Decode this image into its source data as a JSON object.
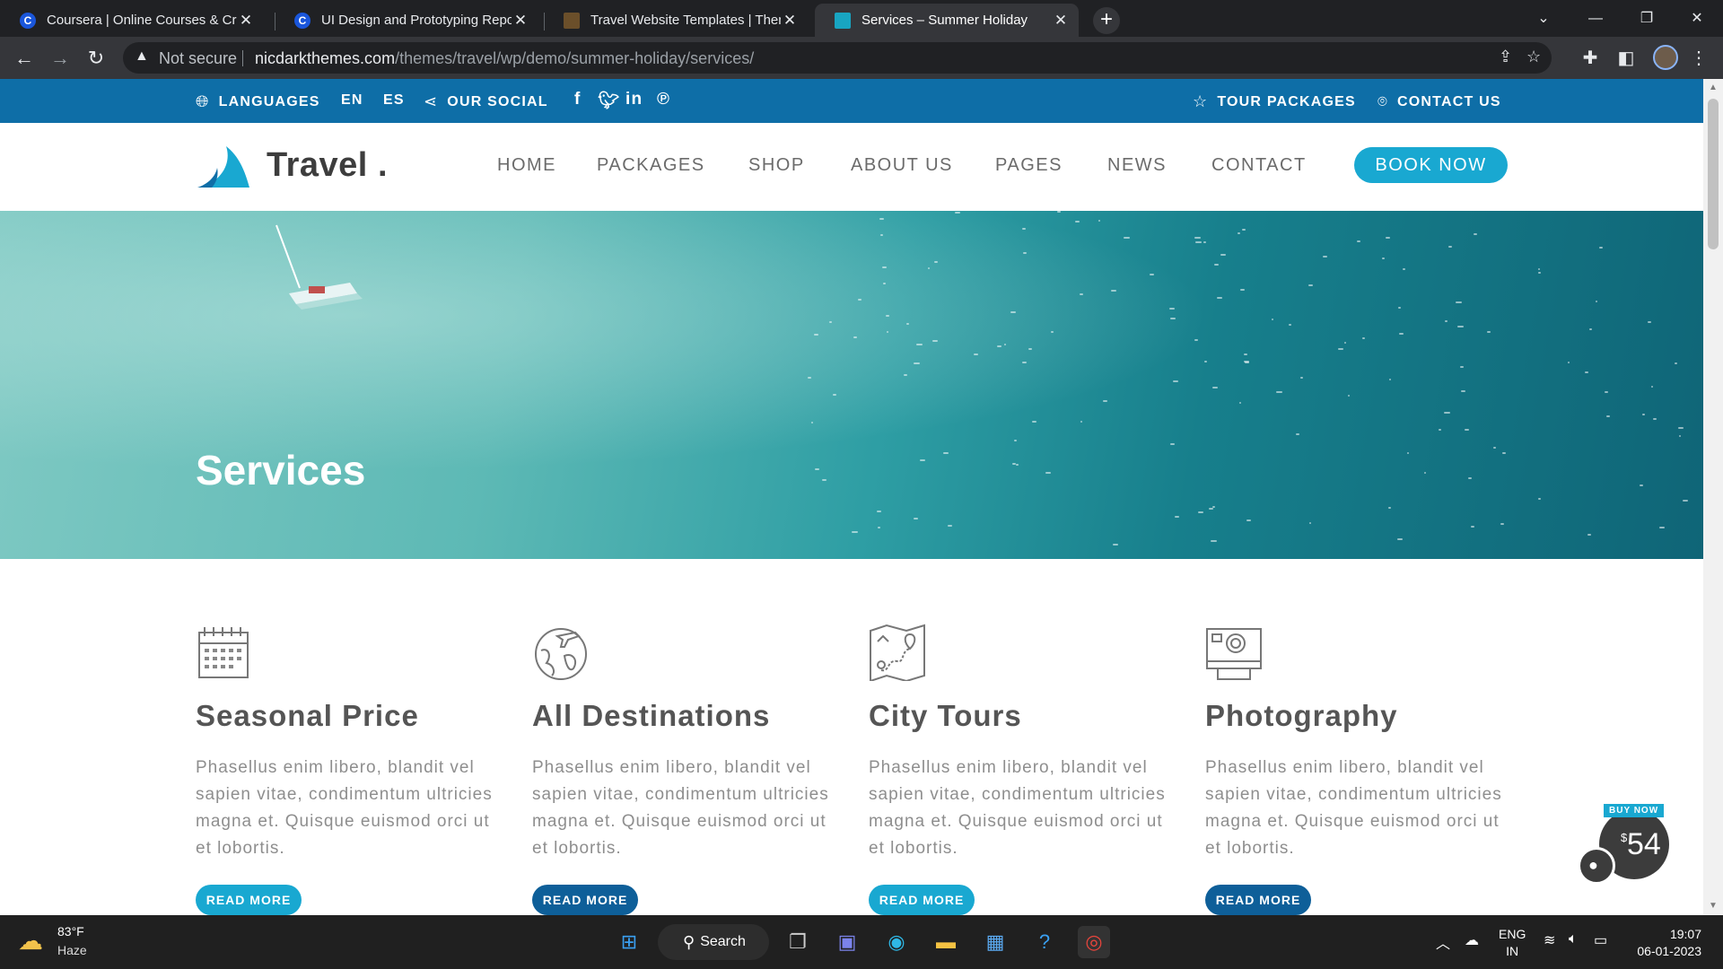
{
  "browser": {
    "tabs": [
      {
        "title": "Coursera | Online Courses & Crec",
        "favicon": "coursera-icon",
        "active": false
      },
      {
        "title": "UI Design and Prototyping Repor",
        "favicon": "coursera-icon",
        "active": false
      },
      {
        "title": "Travel Website Templates | Them",
        "favicon": "themeforest-icon",
        "active": false
      },
      {
        "title": "Services – Summer Holiday",
        "favicon": "nicdark-icon",
        "active": true
      }
    ],
    "new_tab": "+",
    "security_label": "Not secure",
    "url_host": "nicdarkthemes.com",
    "url_path": "/themes/travel/wp/demo/summer-holiday/services/"
  },
  "topbar": {
    "languages": "LANGUAGES",
    "lang_en": "EN",
    "lang_es": "ES",
    "our_social": "OUR SOCIAL",
    "social_icons": [
      "facebook-icon",
      "twitter-icon",
      "linkedin-icon",
      "pinterest-icon"
    ],
    "tour_packages": "TOUR PACKAGES",
    "contact_us": "CONTACT US",
    "bg_color": "#0e6ea7"
  },
  "nav": {
    "logo": "Travel",
    "logo_dot": ".",
    "links": [
      "HOME",
      "PACKAGES",
      "SHOP",
      "ABOUT US",
      "PAGES",
      "NEWS",
      "CONTACT"
    ],
    "book_now": "BOOK NOW",
    "accent": "#19a8d1"
  },
  "hero": {
    "title": "Services"
  },
  "services": [
    {
      "icon": "calendar-icon",
      "title": "Seasonal Price",
      "text": "Phasellus enim libero, blandit vel sapien vitae, condimentum ultricies magna et. Quisque euismod orci ut et lobortis.",
      "button": "READ MORE",
      "button_style": "light"
    },
    {
      "icon": "globe-plane-icon",
      "title": "All Destinations",
      "text": "Phasellus enim libero, blandit vel sapien vitae, condimentum ultricies magna et. Quisque euismod orci ut et lobortis.",
      "button": "READ MORE",
      "button_style": "dark"
    },
    {
      "icon": "map-route-icon",
      "title": "City Tours",
      "text": "Phasellus enim libero, blandit vel sapien vitae, condimentum ultricies magna et. Quisque euismod orci ut et lobortis.",
      "button": "READ MORE",
      "button_style": "light"
    },
    {
      "icon": "camera-icon",
      "title": "Photography",
      "text": "Phasellus enim libero, blandit vel sapien vitae, condimentum ultricies magna et. Quisque euismod orci ut et lobortis.",
      "button": "READ MORE",
      "button_style": "dark"
    }
  ],
  "buy_now": {
    "label": "BUY NOW",
    "currency": "$",
    "price": "54"
  },
  "taskbar": {
    "temperature": "83°F",
    "condition": "Haze",
    "search": "Search",
    "lang_top": "ENG",
    "lang_bottom": "IN",
    "time": "19:07",
    "date": "06-01-2023"
  }
}
